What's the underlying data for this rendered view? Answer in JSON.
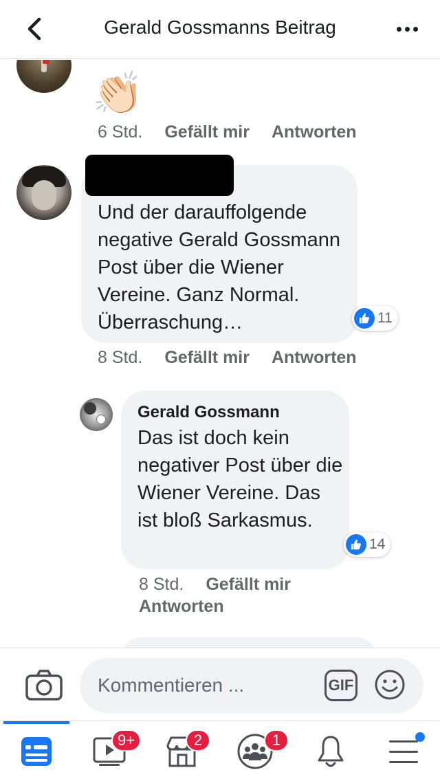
{
  "header": {
    "title": "Gerald Gossmanns Beitrag"
  },
  "comments": [
    {
      "body": "👏🏻",
      "time": "6 Std.",
      "like_label": "Gefällt mir",
      "reply_label": "Antworten"
    },
    {
      "author": "",
      "body": "Und der darauffolgende negative Gerald Gossmann Post über die Wiener Vereine. Ganz Normal. Überraschung…",
      "reactions": "11",
      "time": "8 Std.",
      "like_label": "Gefällt mir",
      "reply_label": "Antworten"
    },
    {
      "author": "Gerald Gossmann",
      "body": "Das ist doch kein negativer Post über die Wiener Vereine. Das ist bloß Sarkasmus.",
      "reactions": "14",
      "time": "8 Std.",
      "like_label": "Gefällt mir",
      "reply_label": "Antworten"
    }
  ],
  "composer": {
    "placeholder": "Kommentieren ...",
    "gif_label": "GIF"
  },
  "tabbar": {
    "badges": {
      "watch": "9+",
      "marketplace": "2",
      "groups": "1"
    }
  },
  "colors": {
    "accent": "#1877f2",
    "badge": "#e41e3f",
    "bubble": "#f0f2f5"
  }
}
